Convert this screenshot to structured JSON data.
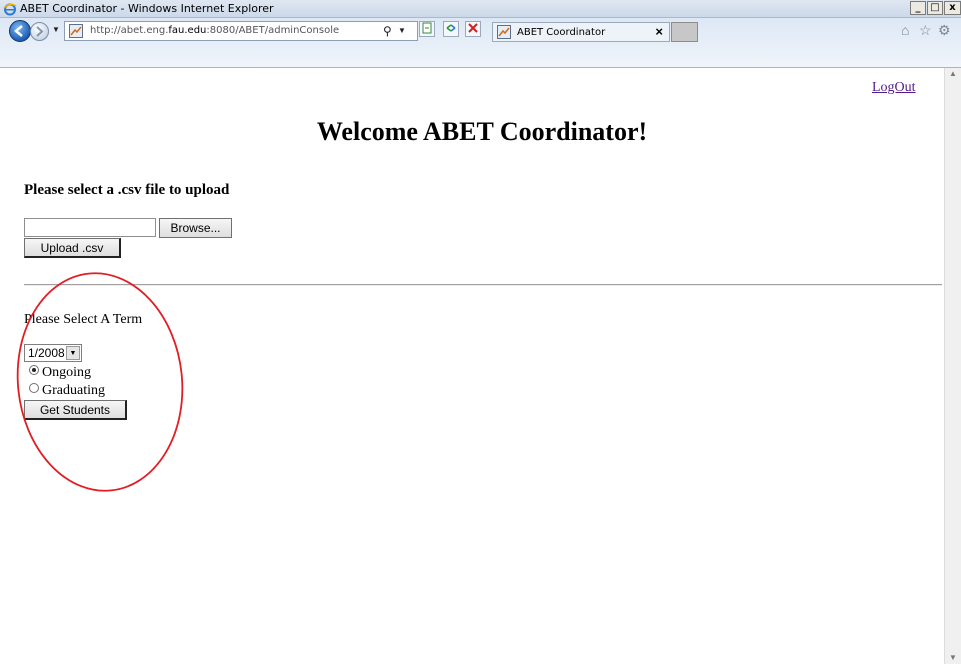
{
  "window": {
    "title": "ABET Coordinator - Windows Internet Explorer",
    "controls": [
      "_",
      "□",
      "x"
    ]
  },
  "browser": {
    "address": {
      "url_prefix": "http://abet.eng.",
      "url_domain": "fau.edu",
      "url_suffix": ":8080/ABET/adminConsole"
    },
    "tab": {
      "label": "ABET Coordinator",
      "close": "×"
    }
  },
  "page": {
    "logout_label": "LogOut",
    "heading": "Welcome ABET Coordinator!",
    "upload": {
      "label": "Please select a .csv file to upload",
      "file_value": "",
      "browse_label": "Browse...",
      "upload_label": "Upload .csv"
    },
    "term": {
      "label": "Please Select A Term",
      "selected": "1/2008",
      "options": [
        {
          "label": "Ongoing",
          "checked": true
        },
        {
          "label": "Graduating",
          "checked": false
        }
      ],
      "submit_label": "Get Students"
    }
  },
  "colors": {
    "annotation_circle": "#e01e24",
    "visited_link": "#551a8b"
  }
}
